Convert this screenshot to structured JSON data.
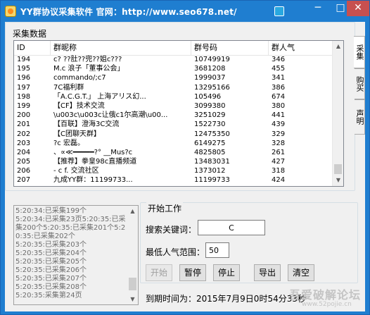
{
  "window": {
    "title": "YY群协议采集软件   官网：http://www.seo678.net/",
    "minimize": "─",
    "maximize": "□",
    "close": "✕"
  },
  "data_group": {
    "label": "采集数据",
    "columns": [
      "ID",
      "群昵称",
      "群号码",
      "群人气"
    ],
    "rows": [
      [
        "194",
        "c? ??肚??兜??姐c???",
        "10749919",
        "346"
      ],
      [
        "195",
        "M.c 浪子「董事公会」",
        "3681208",
        "455"
      ],
      [
        "196",
        "commando/;c7",
        "1999037",
        "341"
      ],
      [
        "197",
        "7C福利群",
        "13295166",
        "386"
      ],
      [
        "198",
        "「A.C.G.T.」 上海アリス幻...",
        "105496",
        "674"
      ],
      [
        "199",
        "【CF】技术交流",
        "3099380",
        "380"
      ],
      [
        "200",
        "\\u003c\\u003c让俄c1尔高潮\\u00...",
        "3251029",
        "441"
      ],
      [
        "201",
        "【百联】澄海3C交流",
        "1522730",
        "439"
      ],
      [
        "202",
        "【C团聊天群】",
        "12475350",
        "329"
      ],
      [
        "203",
        "?c 宏磊。",
        "6149275",
        "328"
      ],
      [
        "204",
        "、∝≪━━━━━?° __Mus?c",
        "4825805",
        "261"
      ],
      [
        "205",
        "【推荐】拳皇98c直播频道",
        "13483031",
        "427"
      ],
      [
        "206",
        "-   c f.   交流社区",
        "1373012",
        "318"
      ],
      [
        "207",
        "九成YY群：11199733...",
        "11199733",
        "424"
      ]
    ]
  },
  "side_tabs": [
    "采集",
    "购买",
    "声明"
  ],
  "log": {
    "text": "5:20:34:已采集199个\n5:20:34:已采集23页5:20:35:已采集200个5:20:35:已采集201个5:20:35:已采集202个\n5:20:35:已采集203个\n5:20:35:已采集204个\n5:20:35:已采集205个\n5:20:35:已采集206个\n5:20:35:已采集207个\n5:20:35:已采集208个\n5:20:35:采集第24页"
  },
  "work_group": {
    "label": "开始工作",
    "keyword_label": "搜索关键词：",
    "keyword_value": "C",
    "popularity_label": "最低人气范围：",
    "popularity_value": "50",
    "buttons": {
      "start": "开始",
      "pause": "暂停",
      "stop": "停止",
      "export": "导出",
      "clear": "清空"
    }
  },
  "expire": {
    "text": "到期时间为：2015年7月9日0时54分33秒"
  },
  "watermark": {
    "main": "吾爱破解论坛",
    "sub": "www.52pojie.cn"
  }
}
